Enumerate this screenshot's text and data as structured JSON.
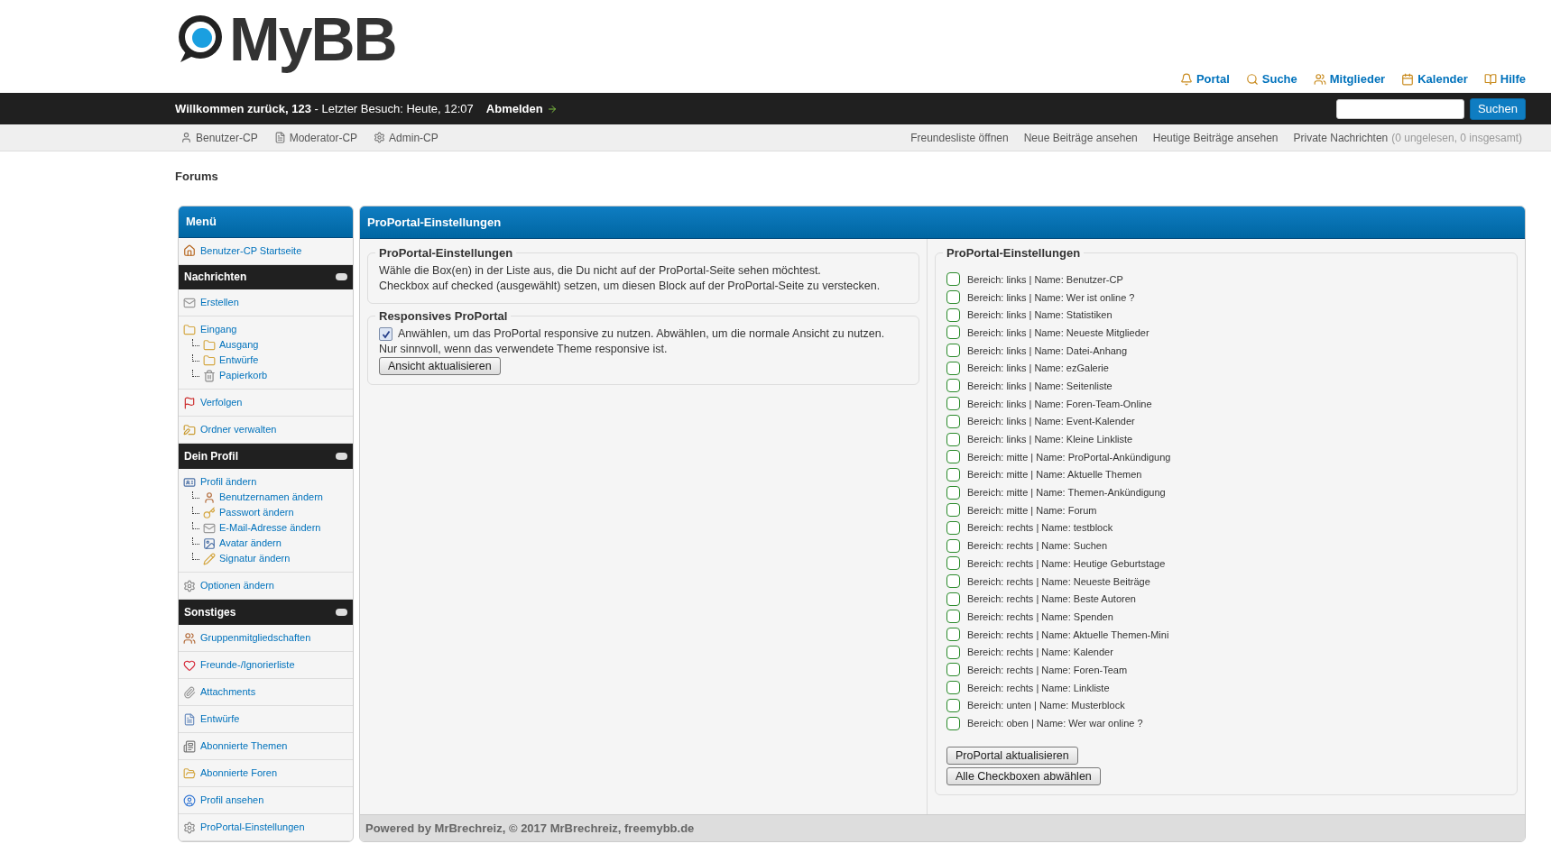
{
  "logo": {
    "text": "MyBB"
  },
  "top_links": [
    {
      "label": "Portal"
    },
    {
      "label": "Suche"
    },
    {
      "label": "Mitglieder"
    },
    {
      "label": "Kalender"
    },
    {
      "label": "Hilfe"
    }
  ],
  "welcome_bar": {
    "greeting": "Willkommen zurück, 123",
    "last_visit": " - Letzter Besuch: Heute, 12:07",
    "logout": "Abmelden",
    "search_button": "Suchen"
  },
  "panel_links": [
    {
      "label": "Benutzer-CP"
    },
    {
      "label": "Moderator-CP"
    },
    {
      "label": "Admin-CP"
    }
  ],
  "quick_links": [
    {
      "label": "Freundesliste öffnen"
    },
    {
      "label": "Neue Beiträge ansehen"
    },
    {
      "label": "Heutige Beiträge ansehen"
    },
    {
      "label": "Private Nachrichten",
      "note": "(0 ungelesen, 0 insgesamt)"
    }
  ],
  "breadcrumb": "Forums",
  "sidebar": {
    "title": "Menü",
    "sections": [
      {
        "items": [
          {
            "label": "Benutzer-CP Startseite"
          }
        ]
      },
      {
        "heading": "Nachrichten",
        "items": [
          {
            "label": "Erstellen"
          },
          {
            "label": "Eingang",
            "children": [
              {
                "label": "Ausgang"
              },
              {
                "label": "Entwürfe"
              },
              {
                "label": "Papierkorb"
              }
            ]
          },
          {
            "label": "Verfolgen"
          },
          {
            "label": "Ordner verwalten"
          }
        ]
      },
      {
        "heading": "Dein Profil",
        "items": [
          {
            "label": "Profil ändern",
            "children": [
              {
                "label": "Benutzernamen ändern"
              },
              {
                "label": "Passwort ändern"
              },
              {
                "label": "E-Mail-Adresse ändern"
              },
              {
                "label": "Avatar ändern"
              },
              {
                "label": "Signatur ändern"
              }
            ]
          },
          {
            "label": "Optionen ändern"
          }
        ]
      },
      {
        "heading": "Sonstiges",
        "items": [
          {
            "label": "Gruppenmitgliedschaften"
          },
          {
            "label": "Freunde-/Ignorierliste"
          },
          {
            "label": "Attachments"
          },
          {
            "label": "Entwürfe"
          },
          {
            "label": "Abonnierte Themen"
          },
          {
            "label": "Abonnierte Foren"
          },
          {
            "label": "Profil ansehen"
          },
          {
            "label": "ProPortal-Einstellungen"
          }
        ]
      }
    ]
  },
  "main": {
    "title": "ProPortal-Einstellungen",
    "intro": {
      "legend": "ProPortal-Einstellungen",
      "lines": [
        "Wähle die Box(en) in der Liste aus, die Du nicht auf der ProPortal-Seite sehen möchtest.",
        "Checkbox auf checked (ausgewählt) setzen, um diesen Block auf der ProPortal-Seite zu verstecken."
      ]
    },
    "responsive": {
      "legend": "Responsives ProPortal",
      "checked": true,
      "label": "Anwählen, um das ProPortal responsive zu nutzen. Abwählen, um die normale Ansicht zu nutzen.",
      "note": "Nur sinnvoll, wenn das verwendete Theme responsive ist.",
      "button": "Ansicht aktualisieren"
    },
    "blocks": {
      "legend": "ProPortal-Einstellungen",
      "items": [
        {
          "label": "Bereich: links | Name: Benutzer-CP",
          "checked": false
        },
        {
          "label": "Bereich: links | Name: Wer ist online ?",
          "checked": false
        },
        {
          "label": "Bereich: links | Name: Statistiken",
          "checked": false
        },
        {
          "label": "Bereich: links | Name: Neueste Mitglieder",
          "checked": false
        },
        {
          "label": "Bereich: links | Name: Datei-Anhang",
          "checked": false
        },
        {
          "label": "Bereich: links | Name: ezGalerie",
          "checked": false
        },
        {
          "label": "Bereich: links | Name: Seitenliste",
          "checked": false
        },
        {
          "label": "Bereich: links | Name: Foren-Team-Online",
          "checked": false
        },
        {
          "label": "Bereich: links | Name: Event-Kalender",
          "checked": false
        },
        {
          "label": "Bereich: links | Name: Kleine Linkliste",
          "checked": false
        },
        {
          "label": "Bereich: mitte | Name: ProPortal-Ankündigung",
          "checked": false
        },
        {
          "label": "Bereich: mitte | Name: Aktuelle Themen",
          "checked": false
        },
        {
          "label": "Bereich: mitte | Name: Themen-Ankündigung",
          "checked": false
        },
        {
          "label": "Bereich: mitte | Name: Forum",
          "checked": false
        },
        {
          "label": "Bereich: rechts | Name: testblock",
          "checked": false
        },
        {
          "label": "Bereich: rechts | Name: Suchen",
          "checked": false
        },
        {
          "label": "Bereich: rechts | Name: Heutige Geburtstage",
          "checked": false
        },
        {
          "label": "Bereich: rechts | Name: Neueste Beiträge",
          "checked": false
        },
        {
          "label": "Bereich: rechts | Name: Beste Autoren",
          "checked": false
        },
        {
          "label": "Bereich: rechts | Name: Spenden",
          "checked": false
        },
        {
          "label": "Bereich: rechts | Name: Aktuelle Themen-Mini",
          "checked": false
        },
        {
          "label": "Bereich: rechts | Name: Kalender",
          "checked": false
        },
        {
          "label": "Bereich: rechts | Name: Foren-Team",
          "checked": false
        },
        {
          "label": "Bereich: rechts | Name: Linkliste",
          "checked": false
        },
        {
          "label": "Bereich: unten | Name: Musterblock",
          "checked": false
        },
        {
          "label": "Bereich: oben | Name: Wer war online ?",
          "checked": false
        }
      ],
      "buttons": [
        "ProPortal aktualisieren",
        "Alle Checkboxen abwählen"
      ]
    },
    "footer": "Powered by MrBrechreiz, © 2017 MrBrechreiz, freemybb.de"
  }
}
